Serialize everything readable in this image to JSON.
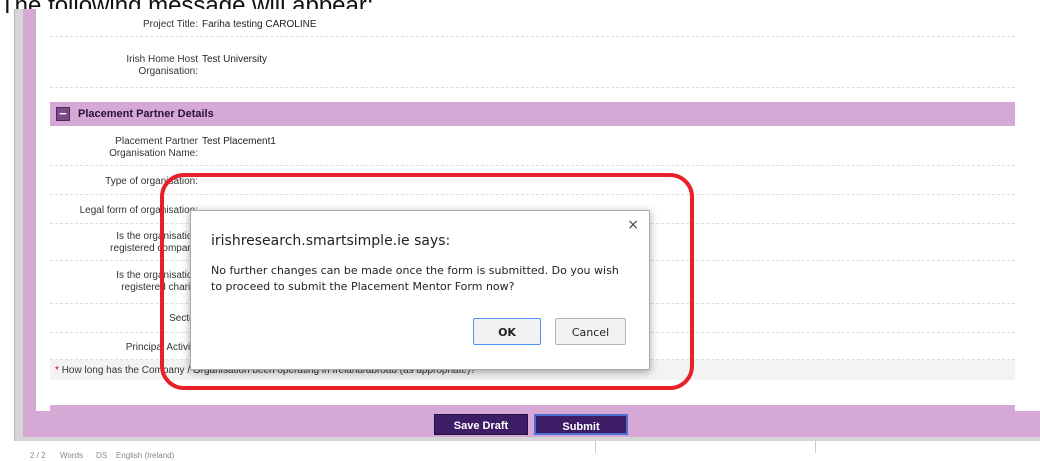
{
  "caption": "The following message will appear:",
  "project": {
    "title_label": "Project Title:",
    "title_value": "Fariha testing CAROLINE",
    "host_label_1": "Irish Home Host",
    "host_label_2": "Organisation:",
    "host_value": "Test University"
  },
  "section": {
    "toggle": "−",
    "title": "Placement Partner Details"
  },
  "fields": {
    "partner_name_label_1": "Placement Partner",
    "partner_name_label_2": "Organisation Name:",
    "partner_name_value": "Test Placement1",
    "type_label": "Type of organisation:",
    "legal_label": "Legal form of organisation:",
    "registered_company_label_1": "Is the organisation",
    "registered_company_label_2": "registered company",
    "registered_charity_label_1": "Is the organisation",
    "registered_charity_label_2": "registered charity",
    "sector_label": "Sector",
    "principal_label": "Principal Activity"
  },
  "question": {
    "required_mark": "*",
    "text": "How long has the Company / Organisation been operating in Ireland/abroad (as appropriate)?"
  },
  "buttons": {
    "save_draft": "Save Draft",
    "submit": "Submit"
  },
  "dialog": {
    "close": "×",
    "title": "irishresearch.smartsimple.ie says:",
    "message": "No further changes can be made once the form is submitted. Do you wish to proceed to submit the Placement Mentor Form now?",
    "ok": "OK",
    "cancel": "Cancel"
  },
  "taskbar": {
    "item1": "2 / 2",
    "item2": "Words",
    "item3": "DS",
    "item4": "English (Ireland)"
  },
  "colors": {
    "section_bg": "#d5a8d6",
    "button_bg": "#3c1d66",
    "highlight": "#e8202a"
  }
}
